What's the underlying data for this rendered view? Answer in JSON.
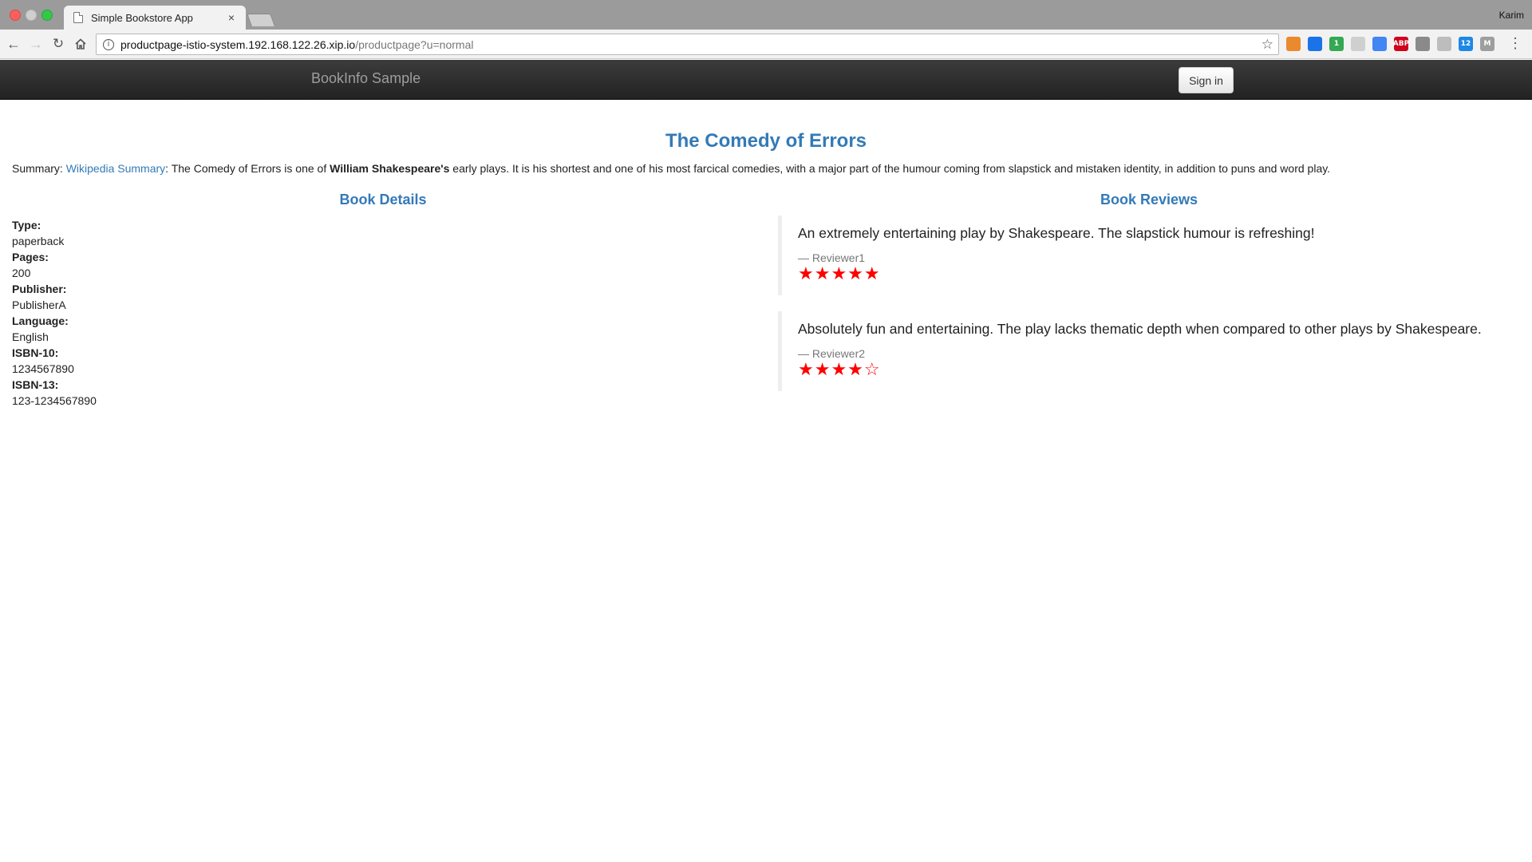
{
  "browser": {
    "tab_title": "Simple Bookstore App",
    "tab_close": "×",
    "profile_name": "Karim",
    "url_host": "productpage-istio-system.192.168.122.26.xip.io",
    "url_path": "/productpage?u=normal",
    "extensions": [
      {
        "name": "extension-1",
        "color": "#e98a2f",
        "label": ""
      },
      {
        "name": "extension-2",
        "color": "#1a73e8",
        "label": ""
      },
      {
        "name": "extension-3",
        "color": "#34a853",
        "label": "1"
      },
      {
        "name": "extension-4",
        "color": "#cfcfcf",
        "label": ""
      },
      {
        "name": "extension-5",
        "color": "#4285f4",
        "label": ""
      },
      {
        "name": "adblock-plus",
        "color": "#d0021b",
        "label": "ABP"
      },
      {
        "name": "cast",
        "color": "#8a8a8a",
        "label": ""
      },
      {
        "name": "extension-8",
        "color": "#bdbdbd",
        "label": ""
      },
      {
        "name": "extension-9",
        "color": "#1e88e5",
        "label": "12"
      },
      {
        "name": "extension-10",
        "color": "#9e9e9e",
        "label": "M"
      }
    ]
  },
  "navbar": {
    "brand": "BookInfo Sample",
    "signin_label": "Sign in"
  },
  "product": {
    "title": "The Comedy of Errors",
    "summary_prefix": "Summary: ",
    "summary_link": "Wikipedia Summary",
    "summary_mid": ": The Comedy of Errors is one of ",
    "summary_bold": "William Shakespeare's",
    "summary_rest": " early plays. It is his shortest and one of his most farcical comedies, with a major part of the humour coming from slapstick and mistaken identity, in addition to puns and word play."
  },
  "details": {
    "heading": "Book Details",
    "type_label": "Type:",
    "type_value": "paperback",
    "pages_label": "Pages:",
    "pages_value": "200",
    "publisher_label": "Publisher:",
    "publisher_value": "PublisherA",
    "language_label": "Language:",
    "language_value": "English",
    "isbn10_label": "ISBN-10:",
    "isbn10_value": "1234567890",
    "isbn13_label": "ISBN-13:",
    "isbn13_value": "123-1234567890"
  },
  "reviews": {
    "heading": "Book Reviews",
    "items": [
      {
        "text": "An extremely entertaining play by Shakespeare. The slapstick humour is refreshing!",
        "author": "— Reviewer1",
        "rating": 5,
        "stars": "★★★★★",
        "star_color": "#ff0000"
      },
      {
        "text": "Absolutely fun and entertaining. The play lacks thematic depth when compared to other plays by Shakespeare.",
        "author": "— Reviewer2",
        "rating": 4,
        "stars": "★★★★☆",
        "star_color": "#ff0000"
      }
    ]
  },
  "colors": {
    "link": "#337ab7",
    "navbar_bg": "#222222",
    "star": "#ff0000"
  }
}
